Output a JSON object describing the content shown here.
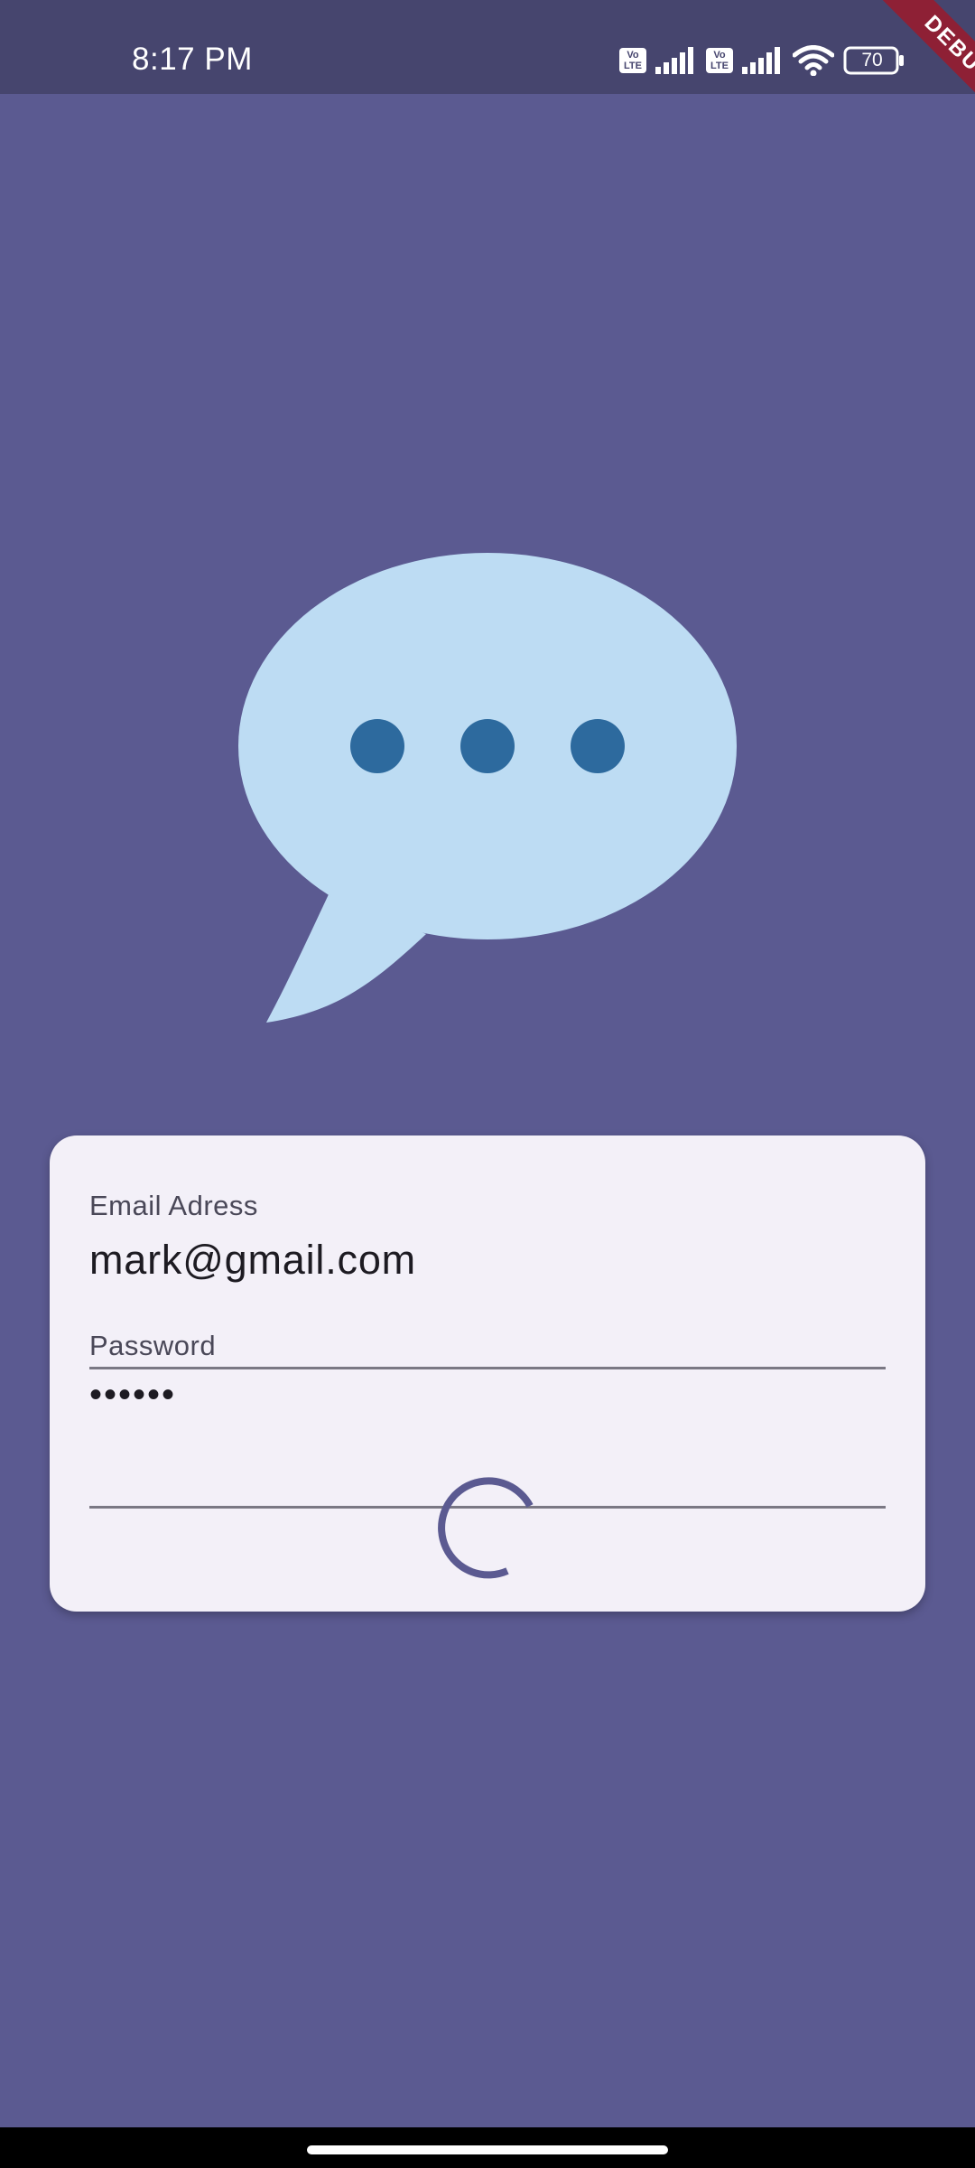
{
  "status_bar": {
    "time": "8:17 PM",
    "sim1_badge": "Vo LTE",
    "sim2_badge": "Vo LTE",
    "battery_level": "70",
    "icons": [
      "volte-icon",
      "signal-icon",
      "volte-icon",
      "signal-icon",
      "wifi-icon",
      "battery-icon"
    ]
  },
  "debug_banner": "DEBUG",
  "logo": {
    "icon": "chat-bubble-icon",
    "bubble_color": "#bddcf3",
    "dot_color": "#2d6a9e"
  },
  "login_form": {
    "email_label": "Email Adress",
    "email_value": "mark@gmail.com",
    "password_label": "Password",
    "password_value": "••••••",
    "loading": true
  },
  "colors": {
    "background": "#5b5a91",
    "status_bar": "#46456e",
    "card": "#f3f0f8",
    "spinner": "#5b5a91"
  }
}
